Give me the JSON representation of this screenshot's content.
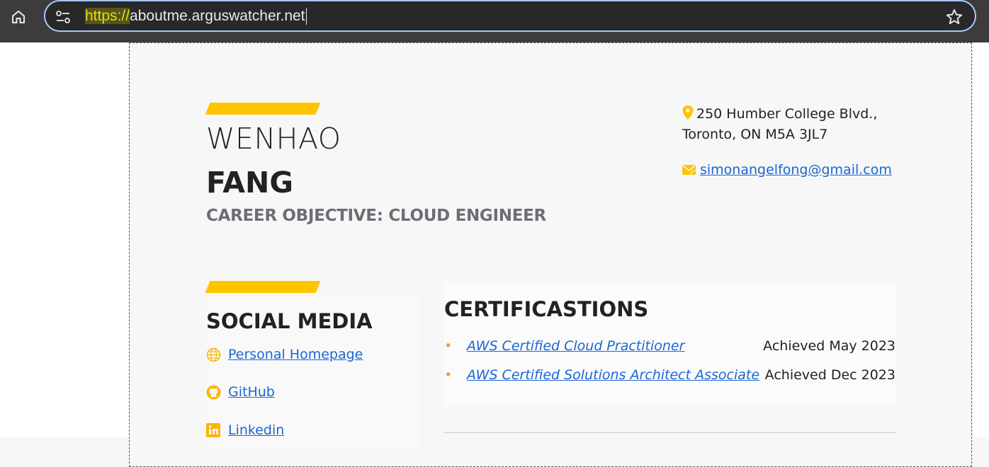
{
  "browser": {
    "url_scheme": "https://",
    "url_host": "aboutme.arguswatcher.net"
  },
  "profile": {
    "first_name": "WENHAO",
    "last_name": "FANG",
    "objective": "CAREER OBJECTIVE: CLOUD ENGINEER",
    "address_line1": "250 Humber College Blvd.,",
    "address_line2": "Toronto, ON M5A 3JL7",
    "email": "simonangelfong@gmail.com"
  },
  "social": {
    "title": "SOCIAL MEDIA",
    "links": [
      {
        "label": "Personal Homepage",
        "icon": "globe-icon"
      },
      {
        "label": "GitHub",
        "icon": "github-icon"
      },
      {
        "label": "Linkedin",
        "icon": "linkedin-icon"
      }
    ]
  },
  "certifications": {
    "title": "CERTIFICASTIONS",
    "items": [
      {
        "name": "AWS Certified Cloud Practitioner",
        "date": "Achieved May 2023"
      },
      {
        "name": "AWS Certified Solutions Architect Associate",
        "date": "Achieved Dec 2023"
      }
    ]
  },
  "colors": {
    "accent": "#ffc400",
    "link": "#1a66d6",
    "bullet": "#f0a030"
  }
}
